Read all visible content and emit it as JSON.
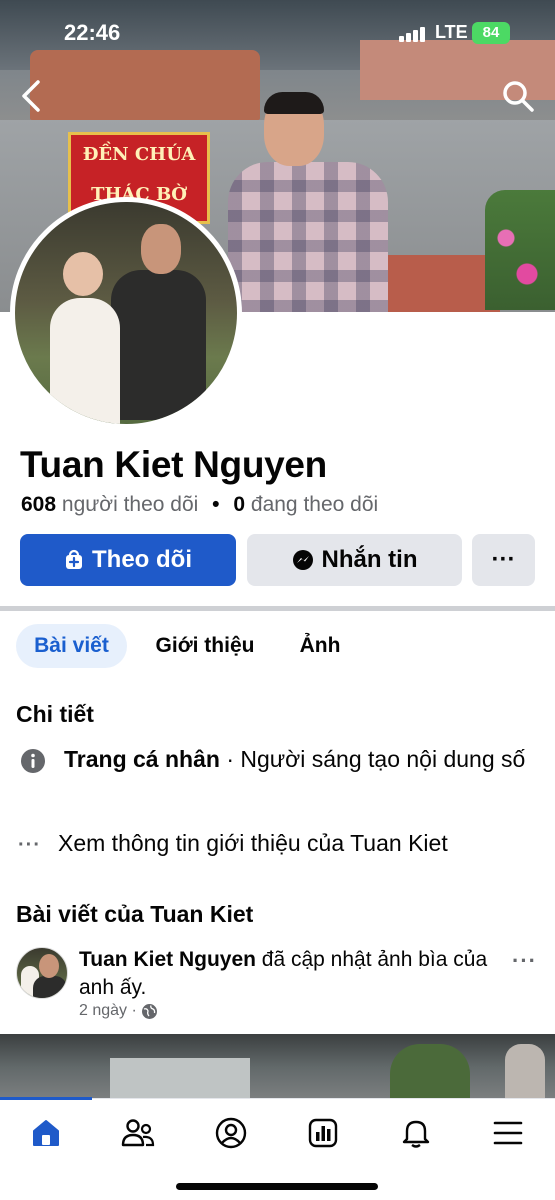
{
  "status_bar": {
    "time": "22:46",
    "network": "LTE",
    "battery": "84"
  },
  "cover": {
    "sign_text": "ĐỀN CHÚA THÁC BỜ"
  },
  "profile": {
    "name": "Tuan Kiet Nguyen",
    "followers_count": "608",
    "followers_label": "người theo dõi",
    "following_count": "0",
    "following_label": "đang theo dõi"
  },
  "actions": {
    "follow_label": "Theo dõi",
    "message_label": "Nhắn tin",
    "more_label": "···"
  },
  "tabs": [
    {
      "label": "Bài viết",
      "active": true
    },
    {
      "label": "Giới thiệu",
      "active": false
    },
    {
      "label": "Ảnh",
      "active": false
    }
  ],
  "details": {
    "title": "Chi tiết",
    "page_type_bold": "Trang cá nhân",
    "page_type_rest": " · Người sáng tạo nội dung số",
    "see_more": "Xem thông tin giới thiệu của Tuan Kiet"
  },
  "posts_section": {
    "title": "Bài viết của Tuan Kiet",
    "post": {
      "author": "Tuan Kiet Nguyen",
      "action": " đã cập nhật ảnh bìa của anh ấy.",
      "time": "2 ngày",
      "separator": " · "
    }
  },
  "colors": {
    "accent": "#1f5ac9",
    "tab_active_bg": "#e7f0fc",
    "button_gray": "#e4e6eb",
    "muted_text": "#65676b"
  },
  "bottom_nav": [
    "home-icon",
    "friends-icon",
    "profile-icon",
    "dashboard-icon",
    "notifications-icon",
    "menu-icon"
  ]
}
